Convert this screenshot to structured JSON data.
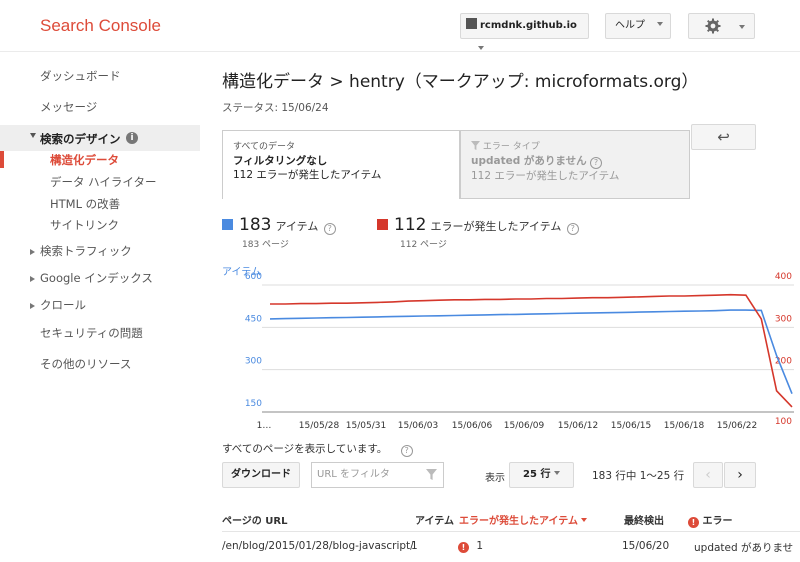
{
  "header": {
    "brand": "Search Console",
    "site": "rcmdnk.github.io",
    "help": "ヘルプ"
  },
  "sidebar": {
    "items": [
      {
        "label": "ダッシュボード"
      },
      {
        "label": "メッセージ"
      },
      {
        "label": "検索のデザイン"
      },
      {
        "label": "構造化データ"
      },
      {
        "label": "データ ハイライター"
      },
      {
        "label": "HTML の改善"
      },
      {
        "label": "サイトリンク"
      },
      {
        "label": "検索トラフィック"
      },
      {
        "label": "Google インデックス"
      },
      {
        "label": "クロール"
      },
      {
        "label": "セキュリティの問題"
      },
      {
        "label": "その他のリソース"
      }
    ]
  },
  "main": {
    "title": "構造化データ > hentry（マークアップ: microformats.org）",
    "status": "ステータス: 15/06/24",
    "tabs": [
      {
        "small": "すべてのデータ",
        "bold": "フィルタリングなし",
        "desc": "112 エラーが発生したアイテム"
      },
      {
        "small": "エラー タイプ",
        "bold": "updated がありません",
        "desc": "112 エラーが発生したアイテム"
      }
    ],
    "legend": [
      {
        "value": "183",
        "label": "アイテム",
        "sub": "183 ページ",
        "color": "#4a8ae0"
      },
      {
        "value": "112",
        "label": "エラーが発生したアイテム",
        "sub": "112 ページ",
        "color": "#d5372b"
      }
    ],
    "listing_text": "すべてのページを表示しています。",
    "download": "ダウンロード",
    "filter_placeholder": "URL をフィルタ",
    "show_label": "表示",
    "rows_select": "25 行",
    "pagination": "183 行中 1〜25 行",
    "table": {
      "headers": [
        "ページの URL",
        "アイテム",
        "エラーが発生したアイテム",
        "最終検出",
        "エラー"
      ],
      "rows": [
        {
          "url": "/en/blog/2015/01/28/blog-javascript/",
          "items": "1",
          "errors": "1",
          "last": "15/06/20",
          "error": "updated がありませ"
        }
      ]
    }
  },
  "chart_data": {
    "type": "line",
    "left_axis_title": "アイテム",
    "yticks_left": [
      150,
      300,
      450,
      600
    ],
    "yticks_right": [
      100,
      200,
      300,
      400
    ],
    "ylim_left": [
      150,
      600
    ],
    "ylim_right": [
      100,
      400
    ],
    "x_tick_labels": [
      "1…",
      "15/05/28",
      "15/05/31",
      "15/06/03",
      "15/06/06",
      "15/06/09",
      "15/06/12",
      "15/06/15",
      "15/06/18",
      "15/06/22"
    ],
    "series": [
      {
        "axis": "left",
        "color": "#4a8ae0",
        "values": [
          480,
          481,
          482,
          483,
          484,
          485,
          486,
          487,
          488,
          489,
          490,
          491,
          492,
          493,
          494,
          495,
          496,
          497,
          498,
          499,
          500,
          501,
          502,
          503,
          504,
          505,
          506,
          507,
          508,
          509,
          511,
          511,
          510,
          350,
          215
        ]
      },
      {
        "axis": "right",
        "color": "#d5372b",
        "values": [
          355,
          355,
          356,
          356,
          357,
          357,
          358,
          359,
          360,
          362,
          363,
          364,
          365,
          365,
          366,
          366,
          367,
          367,
          368,
          368,
          369,
          370,
          370,
          371,
          372,
          373,
          374,
          374,
          375,
          376,
          377,
          376,
          320,
          150,
          112
        ]
      }
    ]
  }
}
